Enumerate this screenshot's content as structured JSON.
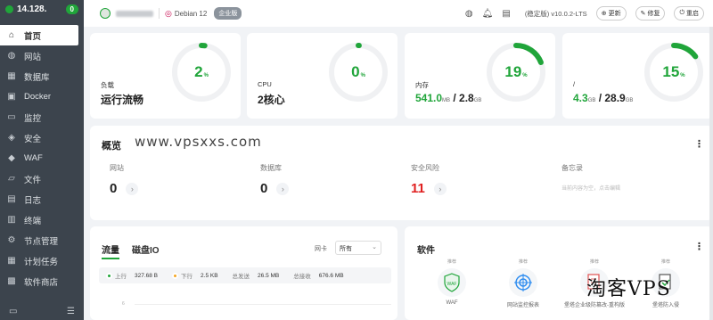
{
  "sidebar": {
    "ip": "14.128.",
    "badge": "0",
    "items": [
      {
        "label": "首页",
        "icon": "home-icon",
        "active": true
      },
      {
        "label": "网站",
        "icon": "globe-icon"
      },
      {
        "label": "数据库",
        "icon": "database-icon"
      },
      {
        "label": "Docker",
        "icon": "docker-icon"
      },
      {
        "label": "监控",
        "icon": "monitor-icon"
      },
      {
        "label": "安全",
        "icon": "shield-icon"
      },
      {
        "label": "WAF",
        "icon": "waf-icon"
      },
      {
        "label": "文件",
        "icon": "folder-icon"
      },
      {
        "label": "日志",
        "icon": "log-icon"
      },
      {
        "label": "终端",
        "icon": "terminal-icon"
      },
      {
        "label": "节点管理",
        "icon": "node-icon"
      },
      {
        "label": "计划任务",
        "icon": "calendar-icon"
      },
      {
        "label": "软件商店",
        "icon": "store-icon"
      }
    ]
  },
  "topbar": {
    "os": "Debian 12",
    "edition": "企业版",
    "version": "(稳定版) v10.0.2-LTS",
    "update": "更新",
    "repair": "修复",
    "restart": "重启"
  },
  "stats": {
    "load": {
      "label": "负载",
      "value": "运行流畅",
      "percent": 2
    },
    "cpu": {
      "label": "CPU",
      "value": "2核心",
      "percent": 0
    },
    "memory": {
      "label": "内存",
      "used": "541.0",
      "used_unit": "MB",
      "total": "2.8",
      "total_unit": "GB",
      "percent": 19
    },
    "disk": {
      "label": "/",
      "used": "4.3",
      "used_unit": "GB",
      "total": "28.9",
      "total_unit": "GB",
      "percent": 15
    }
  },
  "overview": {
    "title": "概览",
    "watermark": "www.vpsxxs.com",
    "items": [
      {
        "label": "网站",
        "value": "0"
      },
      {
        "label": "数据库",
        "value": "0"
      },
      {
        "label": "安全风险",
        "value": "11"
      },
      {
        "label": "备忘录",
        "hint": "当前内容为空，点击编辑"
      }
    ]
  },
  "traffic": {
    "tabs": [
      "流量",
      "磁盘IO"
    ],
    "nic_label": "网卡",
    "nic_value": "所有",
    "upload_label": "上行",
    "upload_value": "327.68 B",
    "download_label": "下行",
    "download_value": "2.5 KB",
    "sent_label": "总发送",
    "sent_value": "26.5 MB",
    "recv_label": "总接收",
    "recv_value": "676.6 MB",
    "axis_tick": "6"
  },
  "software": {
    "title": "软件",
    "items": [
      {
        "tag": "推荐",
        "name": "WAF"
      },
      {
        "tag": "推荐",
        "name": "网站监控报表"
      },
      {
        "tag": "推荐",
        "name": "堡塔企业级防篡改-重构版"
      },
      {
        "tag": "推荐",
        "name": "堡塔防入侵"
      }
    ]
  },
  "brand_watermark": "淘客VPS",
  "colors": {
    "accent": "#20a53a",
    "danger": "#e02020",
    "sidebar": "#3c444d"
  }
}
